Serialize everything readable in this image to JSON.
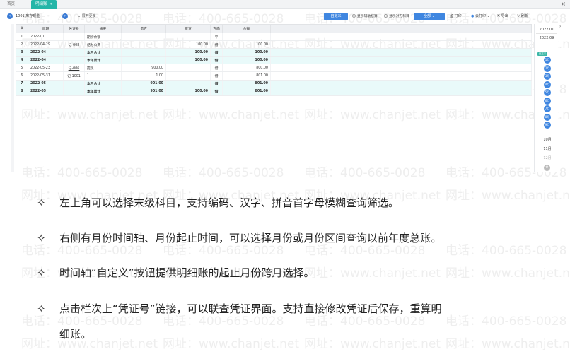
{
  "tabs": {
    "home": "首页",
    "active": "明细账",
    "close": "×"
  },
  "window_close": "×",
  "toolbar": {
    "subject": "1001 库存现金",
    "more": "展开更多",
    "define": "自定义",
    "show_aux": "显示辅助核算",
    "show_opp": "显示对方科目",
    "all_label": "全部",
    "print": "打印",
    "cloud_print": "云打印",
    "export": "导出",
    "refresh": "刷新"
  },
  "table": {
    "headers": [
      "",
      "日期",
      "凭证号",
      "摘要",
      "借方",
      "贷方",
      "方向",
      "余额",
      ""
    ],
    "rows": [
      {
        "no": "1",
        "date": "2022-01",
        "voucher": "",
        "summary": "期初余额",
        "debit": "",
        "credit": "",
        "dir": "平",
        "balance": "",
        "sum": false
      },
      {
        "no": "2",
        "date": "2022-04-29",
        "voucher": "记-008",
        "summary": "结办公费",
        "debit": "",
        "credit": "100.00",
        "dir": "借",
        "balance": "100.00",
        "sum": false
      },
      {
        "no": "3",
        "date": "2022-04",
        "voucher": "",
        "summary": "本月合计",
        "debit": "",
        "credit": "100.00",
        "dir": "借",
        "balance": "100.00",
        "sum": true
      },
      {
        "no": "4",
        "date": "2022-04",
        "voucher": "",
        "summary": "本年累计",
        "debit": "",
        "credit": "100.00",
        "dir": "借",
        "balance": "100.00",
        "sum": true
      },
      {
        "no": "5",
        "date": "2022-05-23",
        "voucher": "记-006",
        "summary": "提现",
        "debit": "900.00",
        "credit": "",
        "dir": "借",
        "balance": "800.00",
        "sum": false
      },
      {
        "no": "6",
        "date": "2022-05-31",
        "voucher": "记-1001",
        "summary": "1",
        "debit": "1.00",
        "credit": "",
        "dir": "借",
        "balance": "801.00",
        "sum": false
      },
      {
        "no": "7",
        "date": "2022-05",
        "voucher": "",
        "summary": "本月合计",
        "debit": "901.00",
        "credit": "",
        "dir": "借",
        "balance": "801.00",
        "sum": true
      },
      {
        "no": "8",
        "date": "2022-05",
        "voucher": "",
        "summary": "本年累计",
        "debit": "901.00",
        "credit": "100.00",
        "dir": "借",
        "balance": "801.00",
        "sum": true
      }
    ]
  },
  "timeline": {
    "year_start": "2022.01",
    "year_end": "2022.09",
    "badge": "自定义",
    "months": [
      "1月",
      "2月",
      "3月",
      "4月",
      "5月",
      "6月",
      "7月",
      "8月",
      "9月"
    ],
    "after": [
      "10月",
      "11月",
      "12月"
    ]
  },
  "bullets": {
    "mark": "✧",
    "items": [
      "左上角可以选择末级科目，支持编码、汉字、拼音首字母模糊查询筛选。",
      "右侧有月份时间轴、月份起止时间，可以选择月份或月份区间查询以前年度总账。",
      "时间轴“自定义”按钮提供明细账的起止月份跨月选择。",
      "点击栏次上“凭证号”链接，可以联查凭证界面。支持直接修改凭证后保存，重算明",
      "细账。"
    ]
  },
  "watermark": {
    "phone": "电话：400-665-0028",
    "site": "网址：www.chanjet.net"
  },
  "colors": {
    "accent": "#24b6a8",
    "button": "#3f86e0",
    "summary_row": "#e9fafa"
  }
}
